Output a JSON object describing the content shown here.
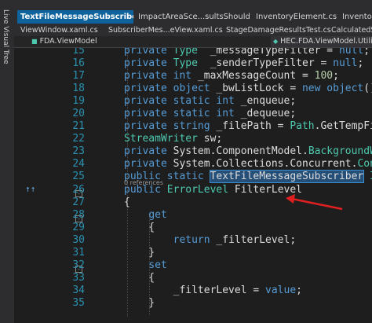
{
  "sidebar": {
    "live_visual_tree": "Live Visual Tree"
  },
  "tabs_row1": [
    {
      "label": "TextFileMessageSubscriber.cs",
      "icons": "⊕ ×",
      "active": true
    },
    {
      "label": "ImpactAreaSce...sultsShould.cs",
      "icons": "",
      "active": false
    },
    {
      "label": "InventoryElement.cs",
      "icons": "",
      "active": false
    },
    {
      "label": "InventorySy",
      "icons": "",
      "active": false
    }
  ],
  "tabs_row2": [
    "ViewWindow.xaml.cs",
    "SubscriberMes...eView.xaml.cs",
    "StageDamageResultsTest.cs",
    "CalculatedStag"
  ],
  "navbar": {
    "left": "FDA.ViewModel",
    "right": "HEC.FDA.ViewModel.Utiliti"
  },
  "code": {
    "lines": [
      {
        "num": "15",
        "segments": [
          [
            "kw",
            "private "
          ],
          [
            "ty",
            "Type"
          ],
          [
            "",
            "  _messageTypeFilter = "
          ],
          [
            "kw",
            "null"
          ],
          [
            "",
            ";"
          ]
        ]
      },
      {
        "num": "16",
        "segments": [
          [
            "kw",
            "private "
          ],
          [
            "ty",
            "Type"
          ],
          [
            "",
            "  _senderTypeFilter = "
          ],
          [
            "kw",
            "null"
          ],
          [
            "",
            ";"
          ]
        ]
      },
      {
        "num": "17",
        "segments": [
          [
            "kw",
            "private int"
          ],
          [
            "",
            " _maxMessageCount = "
          ],
          [
            "nm",
            "100"
          ],
          [
            "",
            ";"
          ]
        ]
      },
      {
        "num": "18",
        "segments": [
          [
            "kw",
            "private object"
          ],
          [
            "",
            " _bwListLock = "
          ],
          [
            "kw",
            "new object"
          ],
          [
            "",
            "();"
          ]
        ]
      },
      {
        "num": "19",
        "segments": [
          [
            "kw",
            "private static int"
          ],
          [
            "",
            " _enqueue;"
          ]
        ]
      },
      {
        "num": "20",
        "segments": [
          [
            "kw",
            "private static int"
          ],
          [
            "",
            " _dequeue;"
          ]
        ]
      },
      {
        "num": "21",
        "segments": [
          [
            "kw",
            "private string"
          ],
          [
            "",
            " _filePath = "
          ],
          [
            "ty",
            "Path"
          ],
          [
            "",
            ".GetTempFileNam"
          ]
        ]
      },
      {
        "num": "22",
        "segments": [
          [
            "ty",
            "StreamWriter"
          ],
          [
            "",
            " sw;"
          ]
        ]
      },
      {
        "num": "23",
        "segments": [
          [
            "kw",
            "private "
          ],
          [
            "",
            "System.ComponentModel."
          ],
          [
            "ty",
            "BackgroundWorker"
          ]
        ]
      },
      {
        "num": "24",
        "segments": [
          [
            "kw",
            "private "
          ],
          [
            "",
            "System.Collections.Concurrent."
          ],
          [
            "ty",
            "Concurre"
          ]
        ]
      },
      {
        "num": "25",
        "segments": [
          [
            "kw",
            "public static "
          ],
          [
            "hl",
            "TextFileMessageSubscriber"
          ],
          [
            "",
            " "
          ],
          [
            "ty",
            "Instan"
          ]
        ]
      },
      {
        "num": "26",
        "segments": [
          [
            "kw",
            "public "
          ],
          [
            "ty",
            "ErrorLevel"
          ],
          [
            "",
            " FilterLevel"
          ]
        ]
      },
      {
        "num": "27",
        "segments": [
          [
            "",
            "{"
          ]
        ]
      },
      {
        "num": "28",
        "segments": [
          [
            "",
            "    "
          ],
          [
            "kw",
            "get"
          ]
        ]
      },
      {
        "num": "29",
        "segments": [
          [
            "",
            "    {"
          ]
        ]
      },
      {
        "num": "30",
        "segments": [
          [
            "",
            "        "
          ],
          [
            "kw",
            "return"
          ],
          [
            "",
            " _filterLevel;"
          ]
        ]
      },
      {
        "num": "31",
        "segments": [
          [
            "",
            "    }"
          ]
        ]
      },
      {
        "num": "32",
        "segments": [
          [
            "",
            "    "
          ],
          [
            "kw",
            "set"
          ]
        ]
      },
      {
        "num": "33",
        "segments": [
          [
            "",
            "    {"
          ]
        ]
      },
      {
        "num": "34",
        "segments": [
          [
            "",
            "        _filterLevel = "
          ],
          [
            "kw",
            "value"
          ],
          [
            "",
            ";"
          ]
        ]
      },
      {
        "num": "35",
        "segments": [
          [
            "",
            "    }"
          ]
        ]
      }
    ],
    "references_label": "0 references"
  },
  "colors": {
    "background": "#1e1e1e",
    "keyword": "#569cd6",
    "type": "#4ec9b0",
    "number": "#b5cea8",
    "line_number": "#2b91af",
    "active_tab": "#0e639c",
    "arrow": "#e02020"
  }
}
